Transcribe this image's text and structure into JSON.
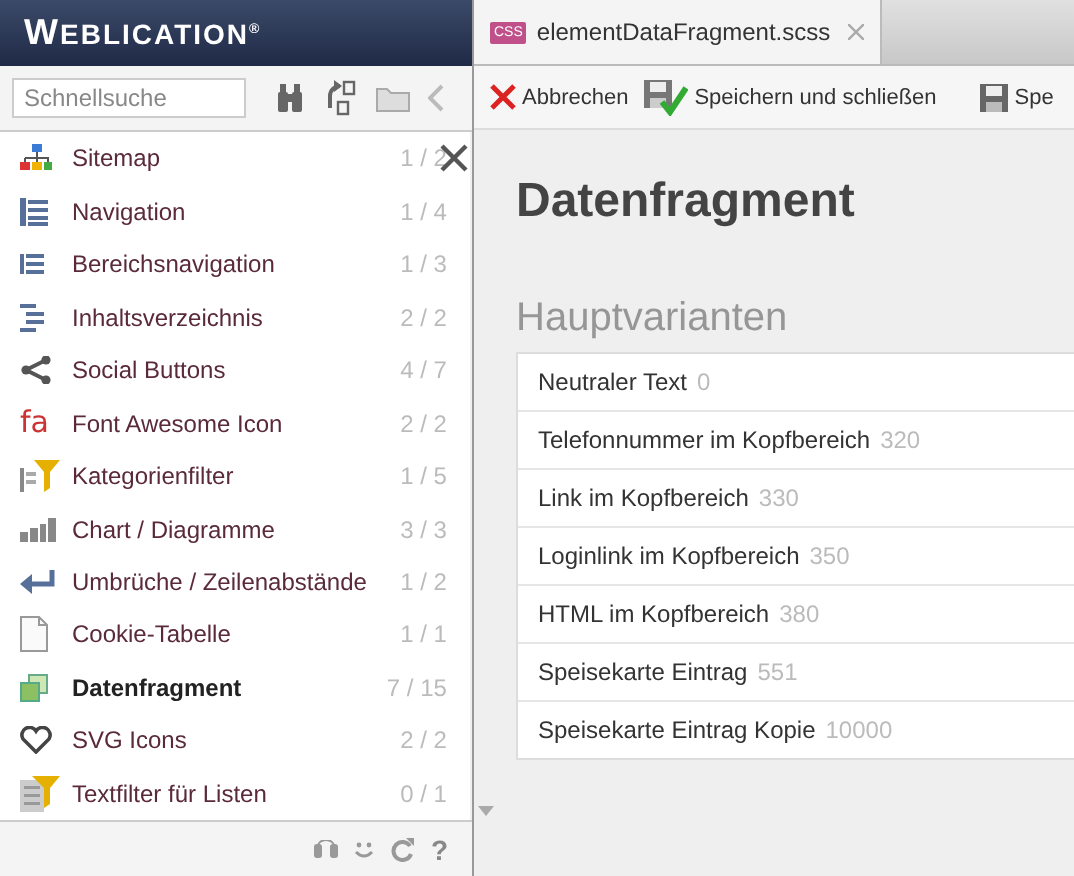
{
  "brand": "WEBLICATION$^{®}$",
  "search": {
    "placeholder": "Schnellsuche"
  },
  "sidebar": {
    "items": [
      {
        "label": "Sitemap",
        "count": "1 / 2",
        "selected": false
      },
      {
        "label": "Navigation",
        "count": "1 / 4",
        "selected": false
      },
      {
        "label": "Bereichsnavigation",
        "count": "1 / 3",
        "selected": false
      },
      {
        "label": "Inhaltsverzeichnis",
        "count": "2 / 2",
        "selected": false
      },
      {
        "label": "Social Buttons",
        "count": "4 / 7",
        "selected": false
      },
      {
        "label": "Font Awesome Icon",
        "count": "2 / 2",
        "selected": false,
        "icon_text": "fa"
      },
      {
        "label": "Kategorienfilter",
        "count": "1 / 5",
        "selected": false
      },
      {
        "label": "Chart / Diagramme",
        "count": "3 / 3",
        "selected": false
      },
      {
        "label": "Umbrüche / Zeilenabstände",
        "count": "1 / 2",
        "selected": false
      },
      {
        "label": "Cookie-Tabelle",
        "count": "1 / 1",
        "selected": false
      },
      {
        "label": "Datenfragment",
        "count": "7 / 15",
        "selected": true
      },
      {
        "label": "SVG Icons",
        "count": "2 / 2",
        "selected": false
      },
      {
        "label": "Textfilter für Listen",
        "count": "0 / 1",
        "selected": false
      }
    ]
  },
  "footer": {
    "help": "?"
  },
  "tabs": [
    {
      "badge": "CSS",
      "label": "elementDataFragment.scss",
      "selected": true
    }
  ],
  "toolbar": [
    "Abbrechen",
    "Speichern und schließen",
    "Spe"
  ],
  "page": {
    "title": "Datenfragment",
    "section": "Hauptvarianten",
    "rows": [
      {
        "name": "Neutraler Text",
        "number": "0"
      },
      {
        "name": "Telefonnummer im Kopfbereich",
        "number": "320"
      },
      {
        "name": "Link im Kopfbereich",
        "number": "330"
      },
      {
        "name": "Loginlink im Kopfbereich",
        "number": "350"
      },
      {
        "name": "HTML im Kopfbereich",
        "number": "380"
      },
      {
        "name": "Speisekarte Eintrag",
        "number": "551"
      },
      {
        "name": "Speisekarte Eintrag Kopie",
        "number": "10000"
      }
    ]
  }
}
